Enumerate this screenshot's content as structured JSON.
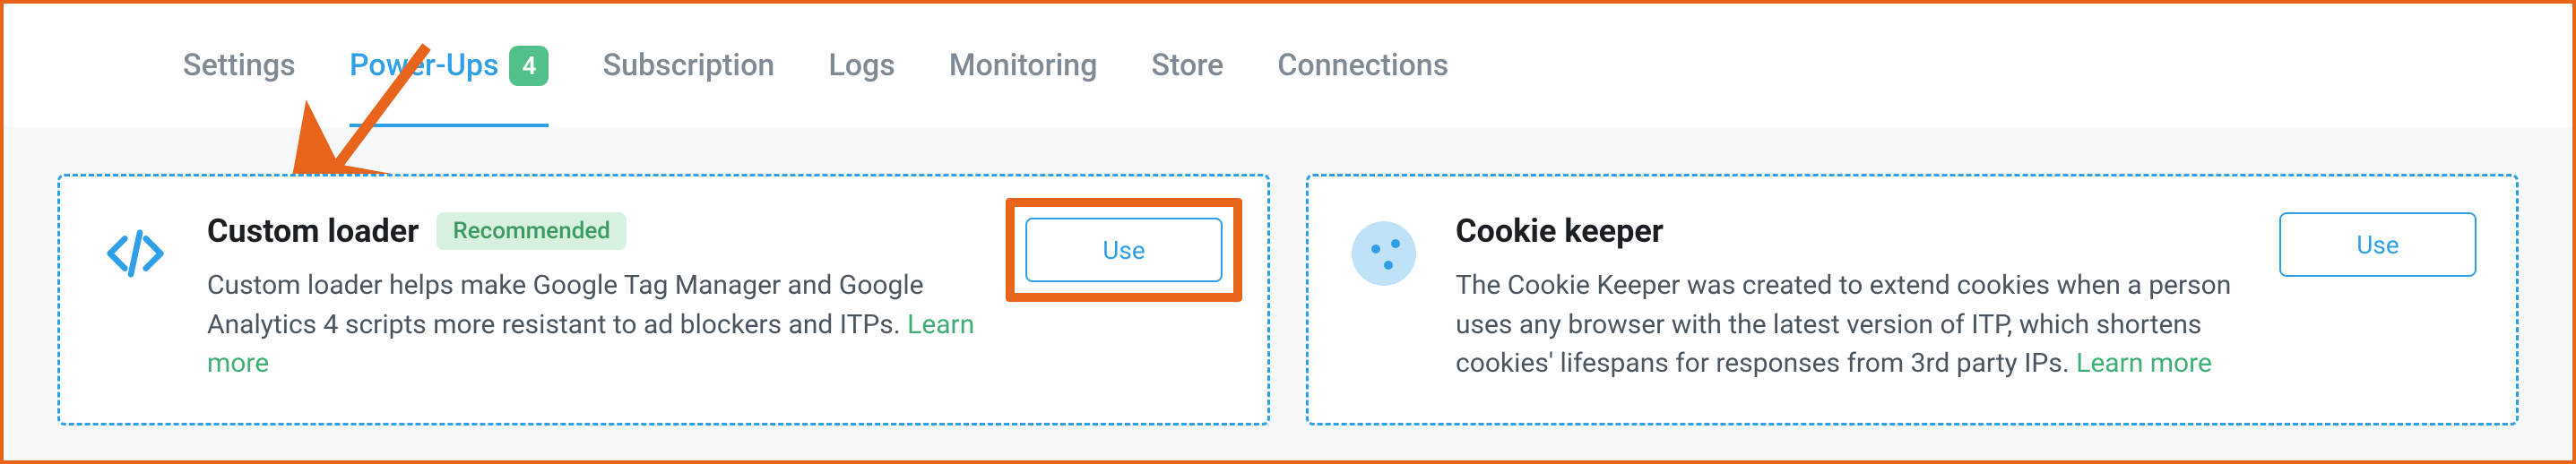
{
  "tabs": {
    "settings": "Settings",
    "powerups": "Power-Ups",
    "powerups_badge": "4",
    "subscription": "Subscription",
    "logs": "Logs",
    "monitoring": "Monitoring",
    "store": "Store",
    "connections": "Connections"
  },
  "cards": {
    "custom_loader": {
      "title": "Custom loader",
      "recommended": "Recommended",
      "desc": "Custom loader helps make Google Tag Manager and Google Analytics 4 scripts more resistant to ad blockers and ITPs. ",
      "learn_more": "Learn more",
      "use": "Use"
    },
    "cookie_keeper": {
      "title": "Cookie keeper",
      "desc": "The Cookie Keeper was created to extend cookies when a person uses any browser with the latest version of ITP, which shortens cookies' lifespans for responses from 3rd party IPs. ",
      "learn_more": "Learn more",
      "use": "Use"
    }
  },
  "colors": {
    "accent_orange": "#e8641b",
    "primary_blue": "#2f9fe8",
    "green": "#3fae74"
  }
}
